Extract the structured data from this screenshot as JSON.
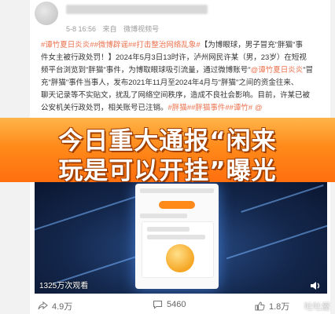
{
  "post": {
    "meta_time": "5-8 16:56",
    "meta_from": "来自",
    "meta_source": "微博视频号",
    "lines": [
      {
        "tags": "#谭竹夏日炎炎##微博辟谣##打击整治网络乱象#",
        "text": "【为博眼球，男子冒充\"胖猫\"事"
      },
      {
        "text": "件女主被行政处罚！】2024年5月3日13时许，泸州网民许某（男，23岁）在短视"
      },
      {
        "text": "频平台浏览到\"胖猫\"事件，为博取眼球吸引流量，通过微博账号\"",
        "link": "@谭竹夏日炎炎",
        "text2": "\"冒"
      },
      {
        "text": "充\"胖猫\"事件当事人，发布2021年11月至2024年4月与\"胖猫\"之间的资金往来、"
      },
      {
        "text": "聊天记录等不实贴文，扰乱了网络空间秩序，造成不良社会影响。目前，许某已被"
      },
      {
        "text": "公安机关行政处罚，相关账号已注销。",
        "tags": "#胖猫##胖猫事件##谭竹# @"
      }
    ]
  },
  "banner": {
    "line1": "今日重大通报“闲来",
    "line2": "玩是可以开挂”曝光"
  },
  "video": {
    "views": "1325万次观看"
  },
  "actions": {
    "share": "4.9万",
    "comments": "5460",
    "likes": "1.8万"
  },
  "watermark": "吐吐屋",
  "colors": {
    "banner_top": "#ffb44a",
    "banner_bottom": "#ff6f0f",
    "tag": "#eb7350"
  }
}
